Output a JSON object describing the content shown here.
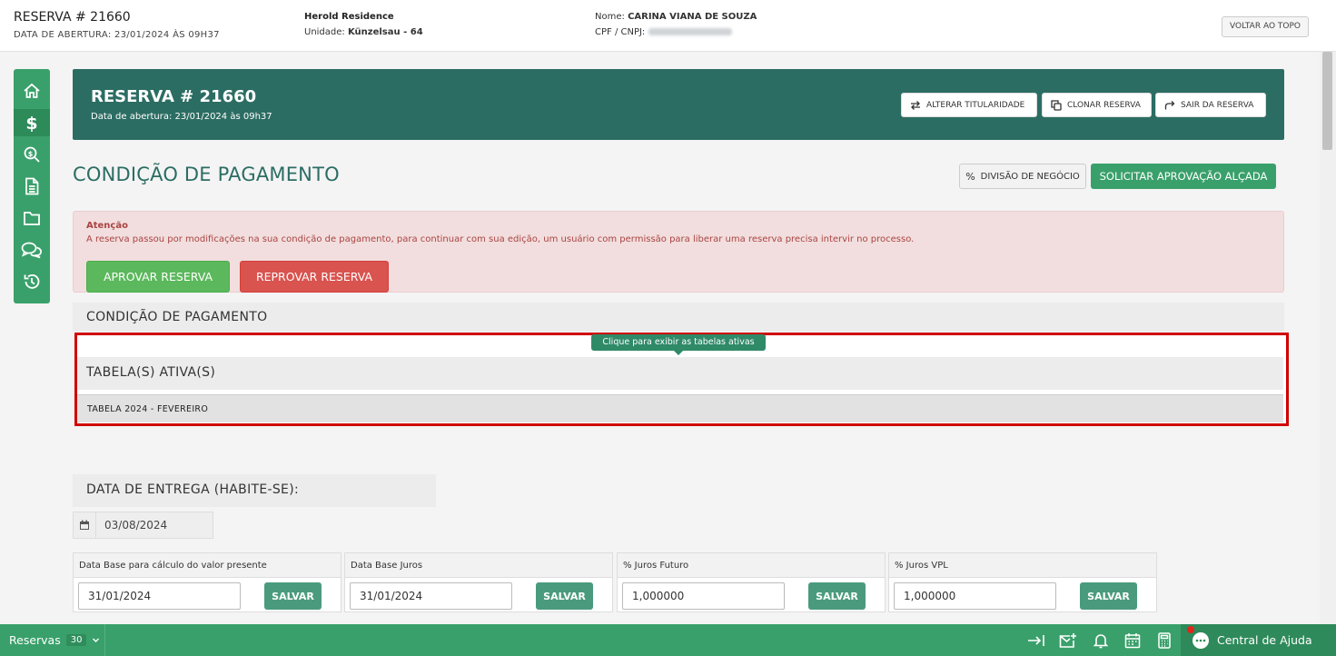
{
  "header": {
    "reserva_title": "RESERVA # 21660",
    "abertura": "DATA DE ABERTURA: 23/01/2024 ÀS 09H37",
    "empreendimento": "Herold Residence",
    "unidade_label": "Unidade:",
    "unidade_value": "Künzelsau - 64",
    "nome_label": "Nome:",
    "nome_value": "CARINA VIANA DE SOUZA",
    "cpf_label": "CPF / CNPJ:",
    "voltar_label": "VOLTAR AO TOPO"
  },
  "sidenav": {
    "items": [
      "home-icon",
      "dollar-icon",
      "search-dollar-icon",
      "document-icon",
      "folder-icon",
      "chat-icon",
      "history-icon"
    ],
    "active_index": 1
  },
  "banner": {
    "title": "RESERVA # 21660",
    "subtitle": "Data de abertura: 23/01/2024 às 09h37",
    "buttons": [
      "ALTERAR TITULARIDADE",
      "CLONAR RESERVA",
      "SAIR DA RESERVA"
    ]
  },
  "page": {
    "title": "CONDIÇÃO DE PAGAMENTO",
    "divisao_label": "DIVISÃO DE NEGÓCIO",
    "solicitar_label": "SOLICITAR APROVAÇÃO ALÇADA"
  },
  "alert": {
    "title": "Atenção",
    "message": "A reserva passou por modificações na sua condição de pagamento, para continuar com sua edição, um usuário com permissão para liberar uma reserva precisa intervir no processo.",
    "approve_label": "APROVAR RESERVA",
    "reject_label": "REPROVAR RESERVA"
  },
  "condicao": {
    "section_title": "CONDIÇÃO DE PAGAMENTO",
    "tooltip": "Clique para exibir as tabelas ativas",
    "tabelas_title": "TABELA(S) ATIVA(S)",
    "tabela_item": "TABELA 2024 - FEVEREIRO"
  },
  "entrega": {
    "title": "DATA DE ENTREGA (HABITE-SE):",
    "date": "03/08/2024"
  },
  "cards": [
    {
      "label": "Data Base para cálculo do valor presente",
      "value": "31/01/2024",
      "button": "SALVAR"
    },
    {
      "label": "Data Base Juros",
      "value": "31/01/2024",
      "button": "SALVAR"
    },
    {
      "label": "% Juros Futuro",
      "value": "1,000000",
      "button": "SALVAR"
    },
    {
      "label": "% Juros VPL",
      "value": "1,000000",
      "button": "SALVAR"
    }
  ],
  "bottombar": {
    "reservas_label": "Reservas",
    "reservas_count": "30",
    "help_label": "Central de Ajuda"
  },
  "colors": {
    "brand_green": "#3aa06b",
    "banner_teal": "#2c6d63",
    "alert_bg": "#f2dede",
    "highlight_red": "#d00000"
  }
}
